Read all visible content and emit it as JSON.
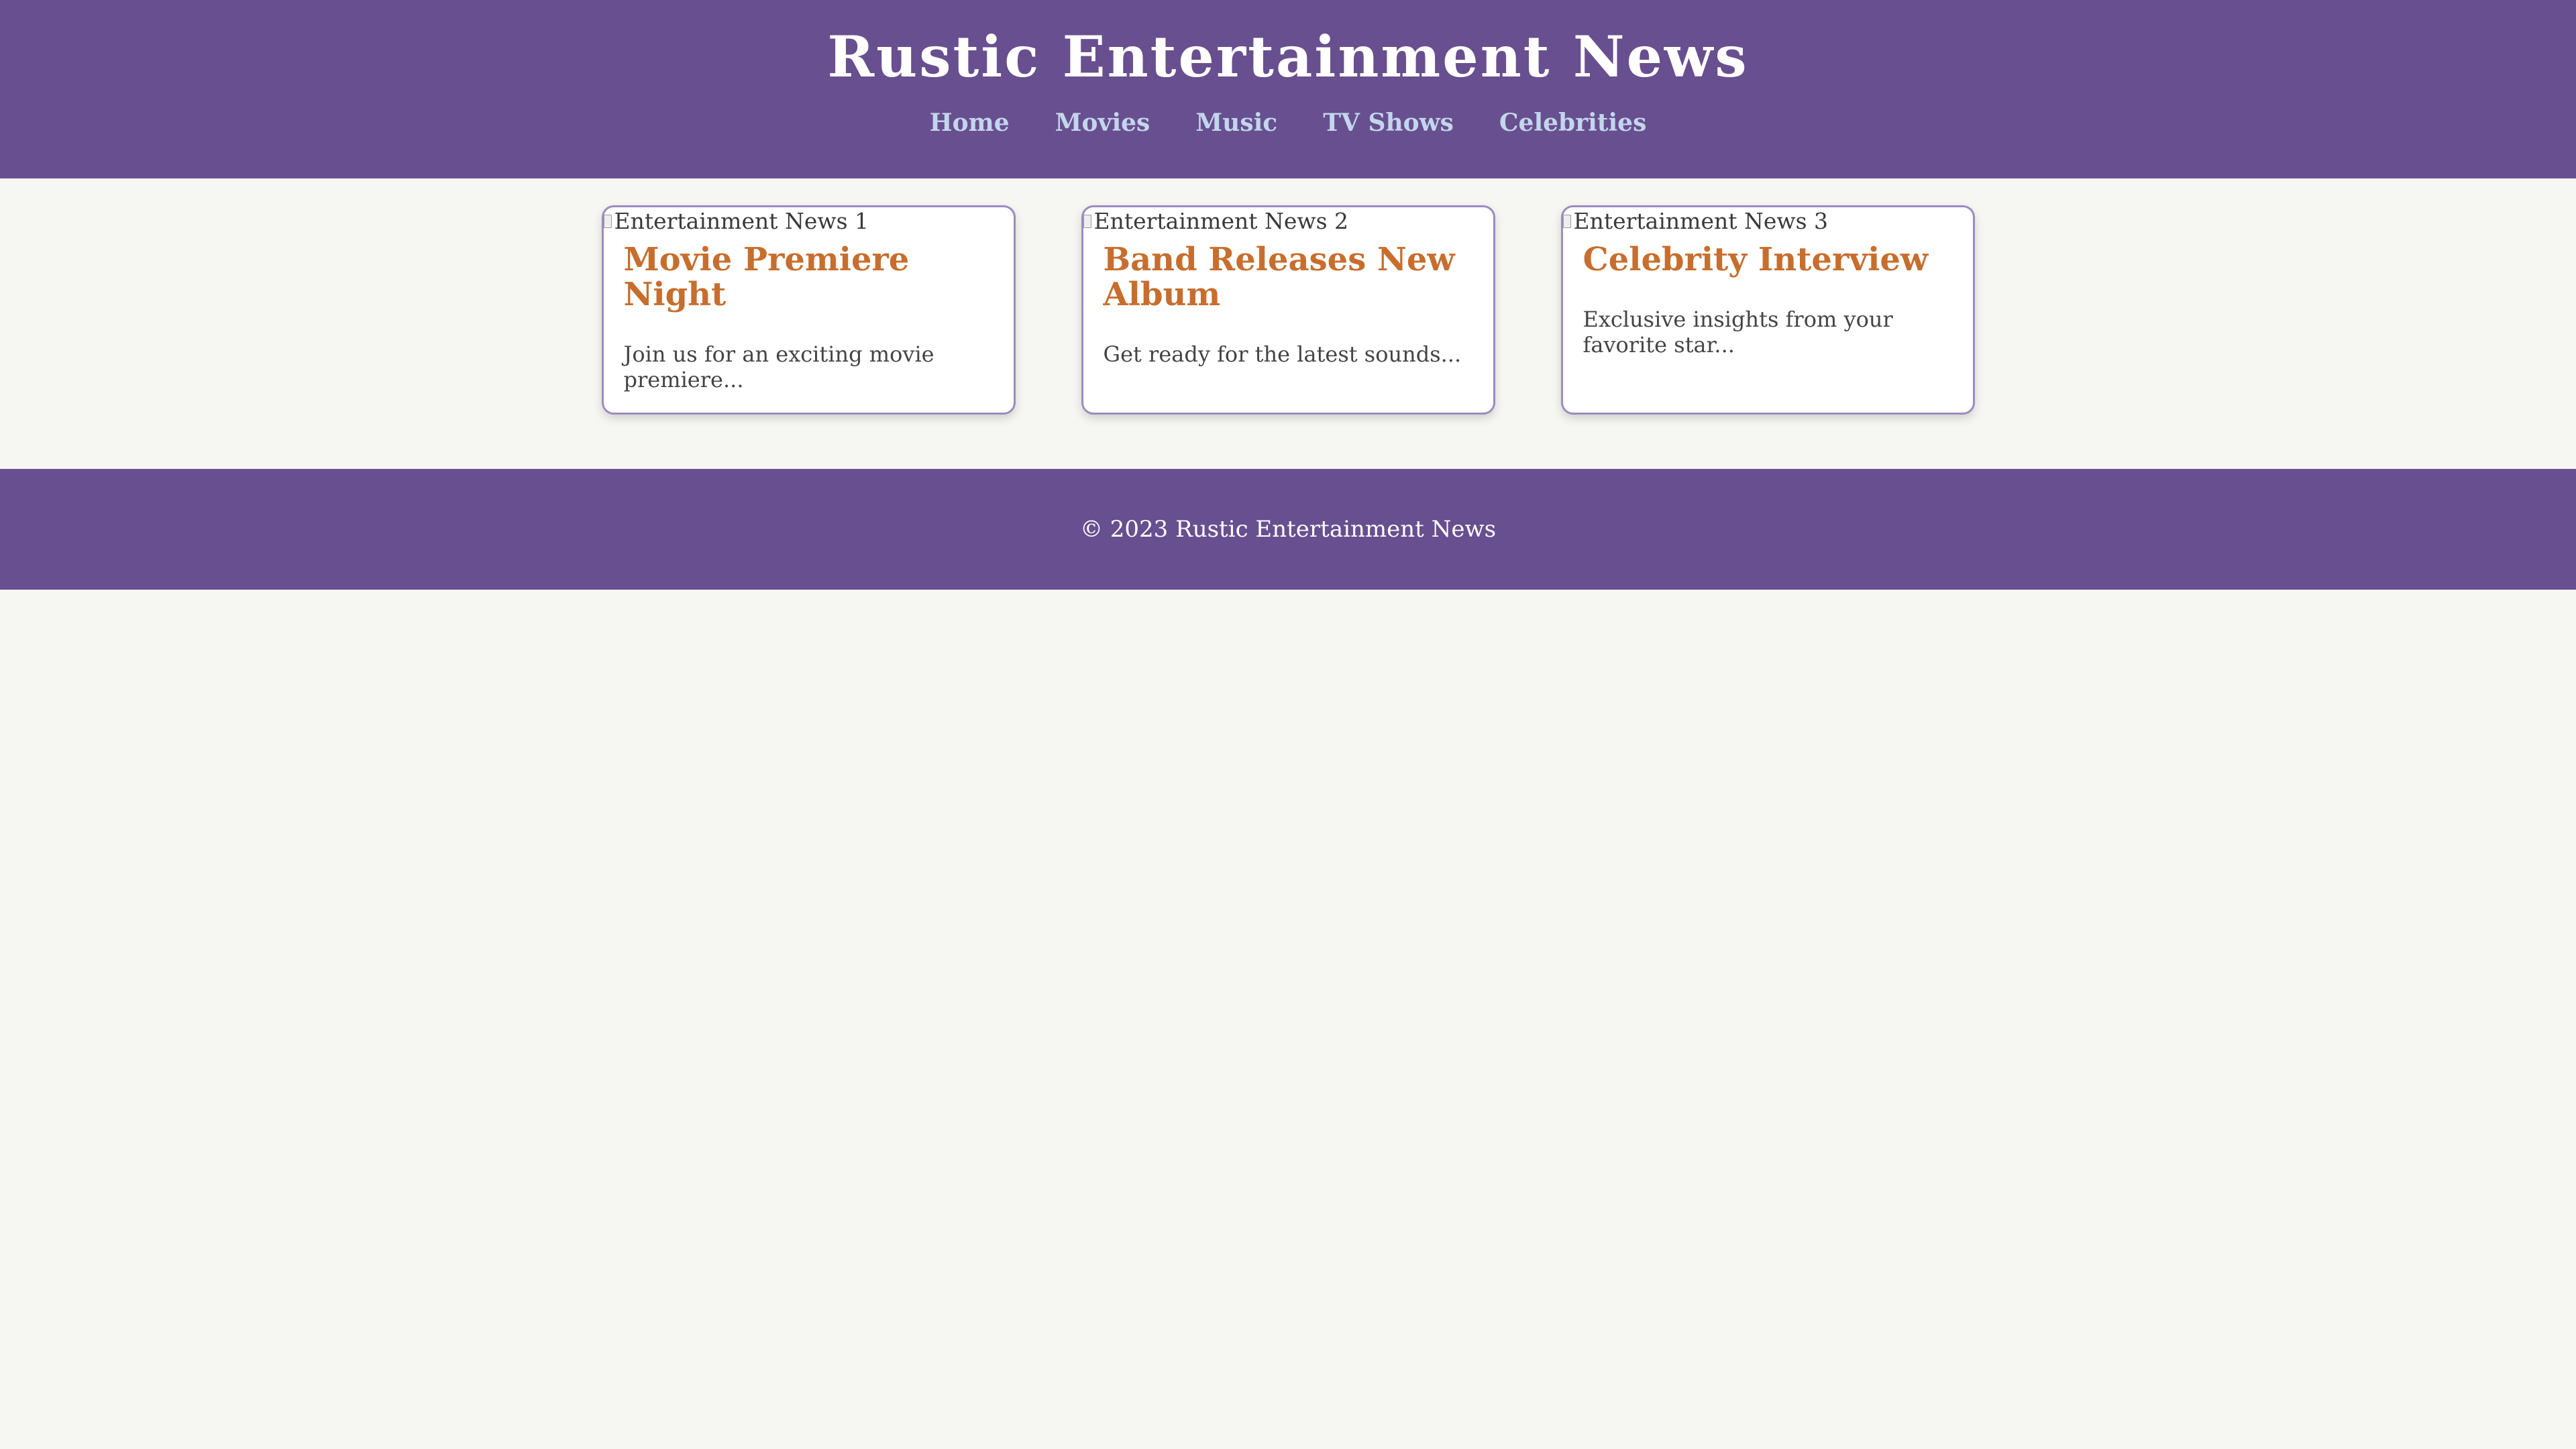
{
  "header": {
    "title": "Rustic Entertainment News",
    "nav": [
      {
        "label": "Home"
      },
      {
        "label": "Movies"
      },
      {
        "label": "Music"
      },
      {
        "label": "TV Shows"
      },
      {
        "label": "Celebrities"
      }
    ]
  },
  "cards": [
    {
      "image_alt": "Entertainment News 1",
      "title": "Movie Premiere Night",
      "text": "Join us for an exciting movie premiere..."
    },
    {
      "image_alt": "Entertainment News 2",
      "title": "Band Releases New Album",
      "text": "Get ready for the latest sounds..."
    },
    {
      "image_alt": "Entertainment News 3",
      "title": "Celebrity Interview",
      "text": "Exclusive insights from your favorite star..."
    }
  ],
  "footer": {
    "copyright": "© 2023 Rustic Entertainment News"
  },
  "colors": {
    "header_bg": "#684f8f",
    "page_bg": "#f6f6f2",
    "nav_link": "#c3d6ec",
    "card_title": "#c76e2e",
    "card_border": "#9b8cc0"
  }
}
